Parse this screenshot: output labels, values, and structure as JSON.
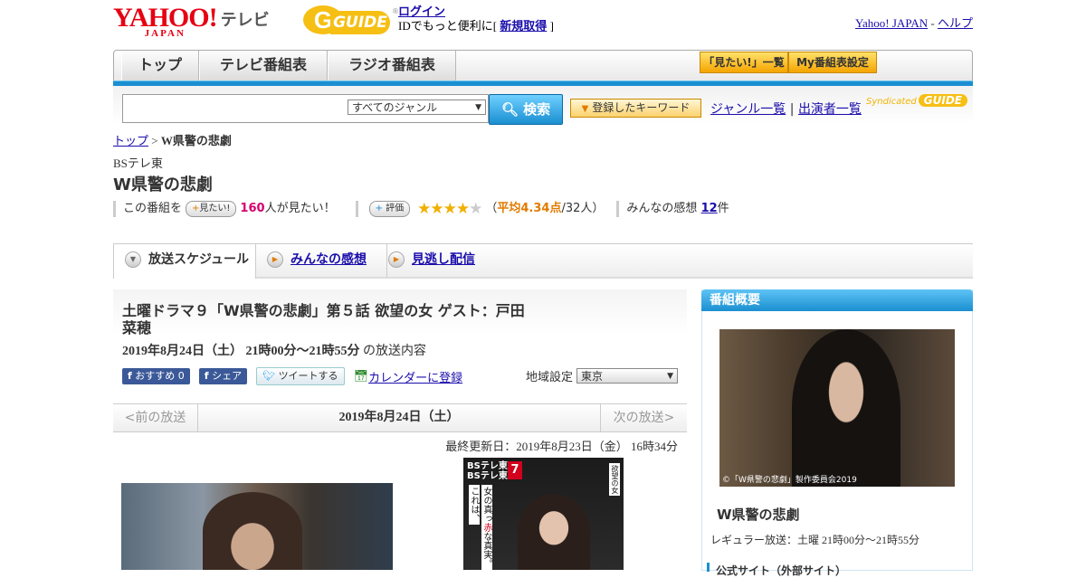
{
  "header": {
    "yahoo_logo": "YAHOO!",
    "yahoo_sub": "JAPAN",
    "service": "テレビ",
    "g": "G",
    "guide": "GUIDE",
    "reg": "®",
    "login_link": "ログイン",
    "login_text_pre": "IDでもっと便利に[",
    "signup_link": "新規取得",
    "login_text_post": "]",
    "yj_link": "Yahoo! JAPAN",
    "sep": " - ",
    "help_link": "ヘルプ"
  },
  "nav": {
    "tabs": [
      "トップ",
      "テレビ番組表",
      "ラジオ番組表"
    ],
    "right_buttons": [
      "「見たい!」一覧",
      "My番組表設定"
    ]
  },
  "search": {
    "genre": "すべてのジャンル",
    "button": "検索",
    "keyword_button": "登録したキーワード",
    "genre_link": "ジャンル一覧",
    "divider": "|",
    "cast_link": "出演者一覧",
    "syndicated": "Syndicated",
    "syndicated_badge": "GUIDE"
  },
  "breadcrumb": {
    "top": "トップ",
    "sep": " > ",
    "current": "W県警の悲劇"
  },
  "program": {
    "station": "BSテレ東",
    "title": "W県警の悲劇",
    "want_pre": "この番組を",
    "want_btn": "見たい!",
    "want_count": "160",
    "want_post": "人が見たい！",
    "rate_btn": "評価",
    "stars_on": "★★★★",
    "stars_off": "★",
    "rating_open": "（",
    "rating_avg": "平均4.34点",
    "rating_count": "/32人）",
    "comments_pre": "みんなの感想",
    "comments_count": "12",
    "comments_post": "件"
  },
  "tabs": [
    {
      "label": "放送スケジュール"
    },
    {
      "label": "みんなの感想"
    },
    {
      "label": "見逃し配信"
    }
  ],
  "episode": {
    "title": "土曜ドラマ９「W県警の悲劇」第５話 欲望の女 ゲスト：戸田菜穂",
    "datetime": "2019年8月24日（土） 21時00分～21時55分",
    "datetime_suffix": " の放送内容",
    "fb_recommend": "おすすめ 0",
    "fb_share": "シェア",
    "tweet": "ツイートする",
    "calendar": "カレンダーに登録",
    "region_label": "地域設定",
    "region_value": "東京"
  },
  "pager": {
    "prev": "<前の放送",
    "date": "2019年8月24日（土）",
    "next": "次の放送>"
  },
  "updated": "最終更新日：2019年8月23日（金） 16時34分",
  "poster": {
    "logo_line1": "BSテレ東",
    "logo_line2": "BSテレ東4K",
    "channel": "7",
    "v1": "これは、",
    "v2_pre": "女の真っ",
    "v2_red": "赤",
    "v2_post": "な真実。",
    "v3": "欲望の女"
  },
  "sidebar": {
    "heading": "番組概要",
    "photo_caption": "©「W県警の悲劇」製作委員会2019",
    "name": "W県警の悲劇",
    "regular": "レギュラー放送：土曜 21時00分～21時55分",
    "official": "公式サイト（外部サイト）"
  },
  "colors": {
    "yahoo_red": "#e60012",
    "guide_yellow": "#f6bf13",
    "accent_blue": "#1a8fd1",
    "pink": "#d6006f",
    "rating_orange": "#e07b00"
  }
}
